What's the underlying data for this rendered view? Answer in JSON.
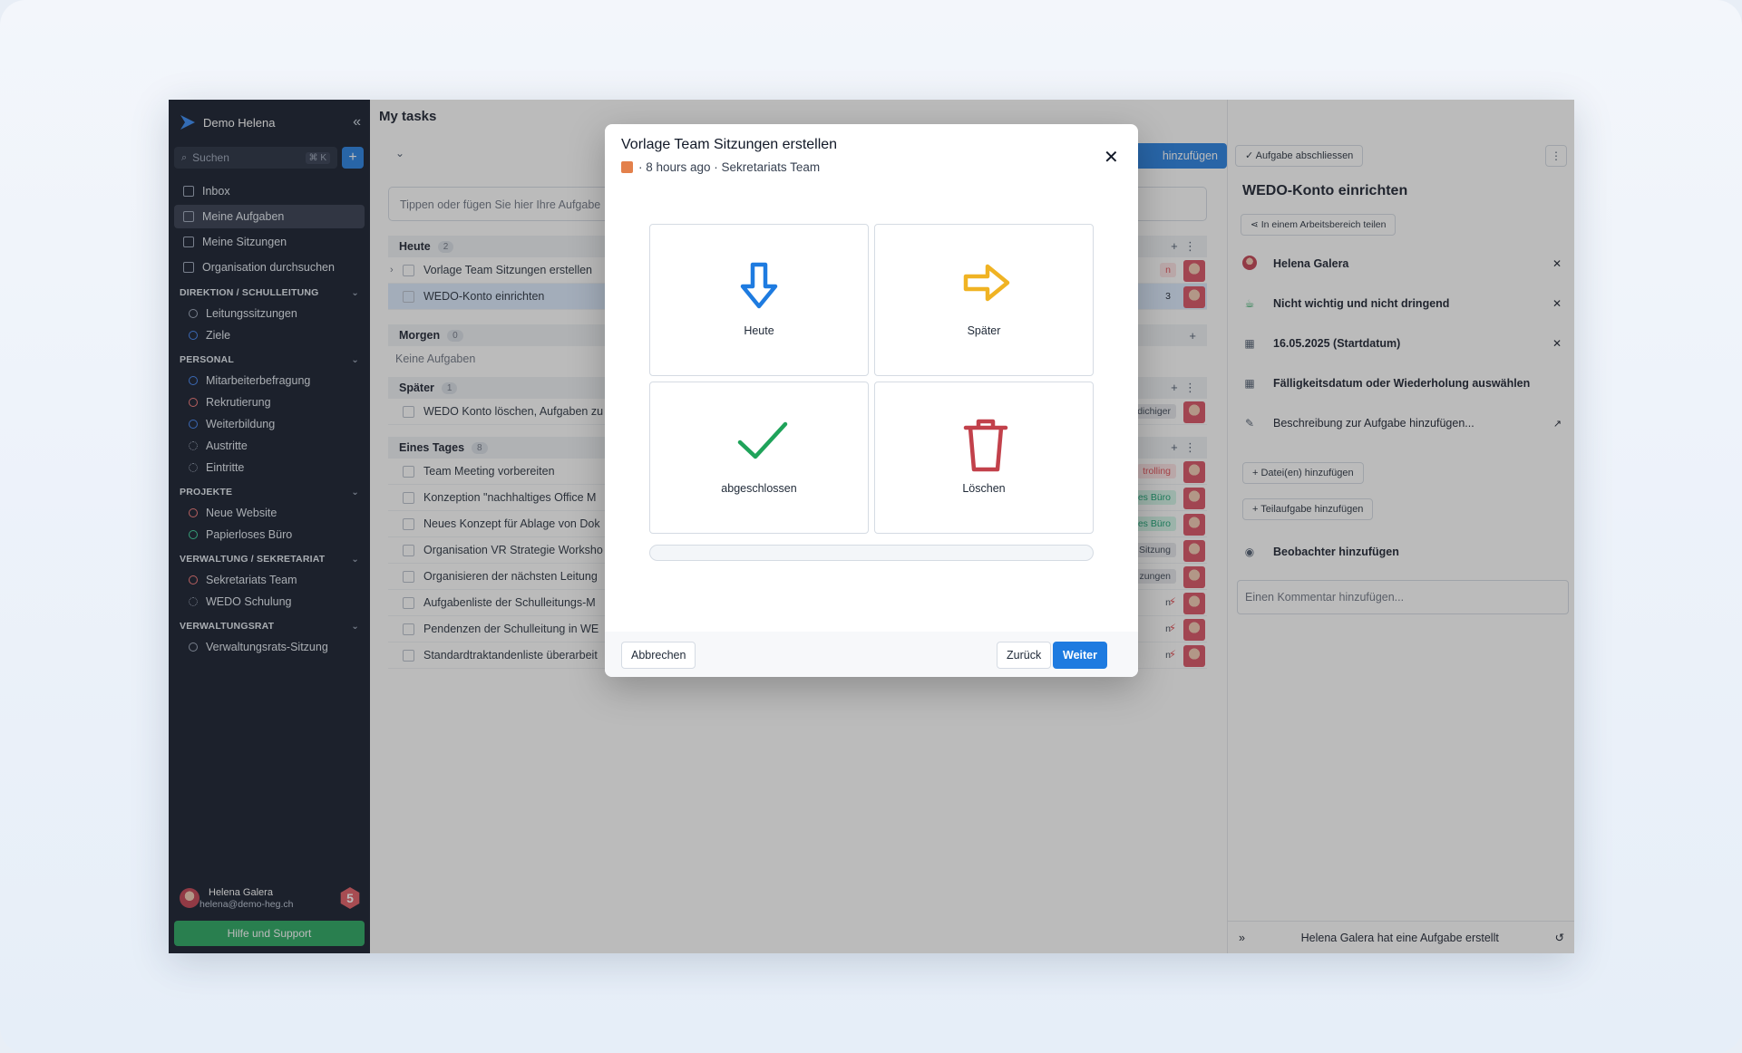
{
  "sidebar": {
    "workspace": "Demo Helena",
    "search_placeholder": "Suchen",
    "search_kbd": "⌘ K",
    "nav": [
      {
        "label": "Inbox"
      },
      {
        "label": "Meine Aufgaben",
        "active": true
      },
      {
        "label": "Meine Sitzungen"
      },
      {
        "label": "Organisation durchsuchen"
      }
    ],
    "sections": [
      {
        "title": "DIREKTION / SCHULLEITUNG",
        "items": [
          {
            "label": "Leitungssitzungen",
            "color": "#9aa5b8"
          },
          {
            "label": "Ziele",
            "color": "#3b82f6"
          }
        ]
      },
      {
        "title": "PERSONAL",
        "items": [
          {
            "label": "Mitarbeiterbefragung",
            "color": "#3b82f6"
          },
          {
            "label": "Rekrutierung",
            "color": "#f97373"
          },
          {
            "label": "Weiterbildung",
            "color": "#3b82f6"
          },
          {
            "label": "Austritte",
            "color": "#9aa5b8"
          },
          {
            "label": "Eintritte",
            "color": "#9aa5b8"
          }
        ]
      },
      {
        "title": "PROJEKTE",
        "items": [
          {
            "label": "Neue Website",
            "color": "#f97373"
          },
          {
            "label": "Papierloses Büro",
            "color": "#34d399"
          }
        ]
      },
      {
        "title": "VERWALTUNG / SEKRETARIAT",
        "items": [
          {
            "label": "Sekretariats Team",
            "color": "#f97373"
          },
          {
            "label": "WEDO Schulung",
            "color": "#9aa5b8"
          }
        ]
      },
      {
        "title": "VERWALTUNGSRAT",
        "items": [
          {
            "label": "Verwaltungsrats-Sitzung",
            "color": "#9aa5b8"
          }
        ]
      }
    ],
    "user": {
      "name": "Helena Galera",
      "email": "helena@demo-heg.ch",
      "badge": "5"
    },
    "help": "Hilfe und Support"
  },
  "main": {
    "title": "My tasks",
    "add_button": "hinzufügen",
    "input_placeholder": "Tippen oder fügen Sie hier Ihre Aufgabe",
    "groups": {
      "heute": {
        "title": "Heute",
        "count": "2",
        "tasks": [
          {
            "label": "Vorlage Team Sitzungen erstellen",
            "tag": "n"
          },
          {
            "label": "WEDO-Konto einrichten",
            "tag": "3"
          }
        ]
      },
      "morgen": {
        "title": "Morgen",
        "count": "0",
        "empty": "Keine Aufgaben"
      },
      "spaeter": {
        "title": "Später",
        "count": "1",
        "tasks": [
          {
            "label": "WEDO Konto löschen, Aufgaben zu",
            "tag": "dichiger"
          }
        ]
      },
      "eines": {
        "title": "Eines Tages",
        "count": "8",
        "tasks": [
          {
            "label": "Team Meeting vorbereiten",
            "tag": "trolling"
          },
          {
            "label": "Konzeption \"nachhaltiges Office M",
            "tag": "es Büro"
          },
          {
            "label": "Neues Konzept für Ablage von Dok",
            "tag": "es Büro"
          },
          {
            "label": "Organisation VR Strategie Worksho",
            "tag": "Sitzung"
          },
          {
            "label": "Organisieren der nächsten Leitung",
            "tag": "zungen"
          },
          {
            "label": "Aufgabenliste der Schulleitungs-M",
            "tag": "n"
          },
          {
            "label": "Pendenzen der Schulleitung in WE",
            "tag": "n"
          },
          {
            "label": "Standardtraktandenliste überarbeit",
            "tag": "n"
          }
        ]
      }
    }
  },
  "right": {
    "complete_button": "Aufgabe abschliessen",
    "title": "WEDO-Konto einrichten",
    "share_button": "In einem Arbeitsbereich teilen",
    "assignee": "Helena Galera",
    "priority": "Nicht wichtig und nicht dringend",
    "start_date": "16.05.2025  (Startdatum)",
    "due_placeholder": "Fälligkeitsdatum oder Wiederholung auswählen",
    "description_placeholder": "Beschreibung zur Aufgabe hinzufügen...",
    "add_file": "Datei(en) hinzufügen",
    "add_subtask": "Teilaufgabe hinzufügen",
    "add_watcher": "Beobachter hinzufügen",
    "comment_placeholder": "Einen Kommentar hinzufügen...",
    "footer_text": "Helena Galera hat eine Aufgabe erstellt"
  },
  "modal": {
    "title": "Vorlage Team Sitzungen erstellen",
    "subtitle": "· 8 hours ago · Sekretariats Team",
    "options": {
      "today": "Heute",
      "later": "Später",
      "done": "abgeschlossen",
      "delete": "Löschen"
    },
    "cancel": "Abbrechen",
    "back": "Zurück",
    "next": "Weiter",
    "progress": 0
  },
  "colors": {
    "accent": "#1e7be0",
    "today_arrow": "#1e7be0",
    "later_arrow": "#f0b323",
    "done_check": "#1fa35a",
    "delete_bin": "#c2414b"
  }
}
